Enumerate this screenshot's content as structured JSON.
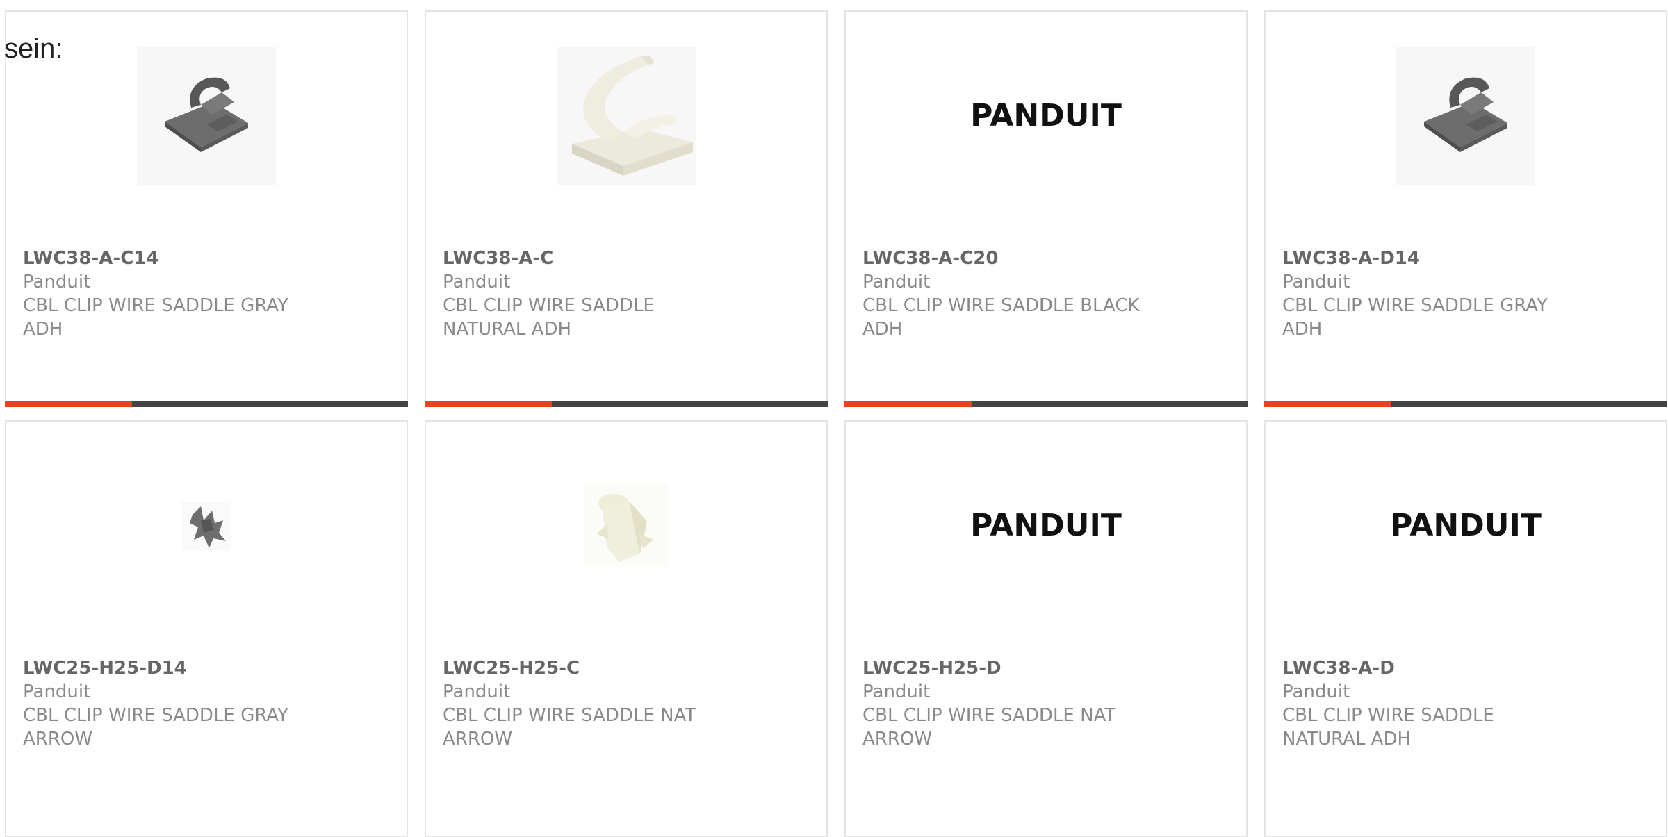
{
  "intro_text": "sein:",
  "colors": {
    "accent": "#e8431f",
    "bar_dark": "#444444",
    "card_border": "#e4e4e4",
    "text_gray": "#8a8a8a"
  },
  "products": [
    {
      "part": "LWC38-A-C14",
      "brand": "Panduit",
      "desc_line1": "CBL CLIP WIRE SADDLE GRAY",
      "desc_line2": "ADH",
      "image": "gray-adhesive-clip-image"
    },
    {
      "part": "LWC38-A-C",
      "brand": "Panduit",
      "desc_line1": "CBL CLIP WIRE SADDLE",
      "desc_line2": "NATURAL ADH",
      "image": "natural-adhesive-clip-image"
    },
    {
      "part": "LWC38-A-C20",
      "brand": "Panduit",
      "desc_line1": "CBL CLIP WIRE SADDLE BLACK",
      "desc_line2": "ADH",
      "image": "panduit-logo",
      "logo_text": "PANDUIT"
    },
    {
      "part": "LWC38-A-D14",
      "brand": "Panduit",
      "desc_line1": "CBL CLIP WIRE SADDLE GRAY",
      "desc_line2": "ADH",
      "image": "gray-adhesive-clip-image"
    },
    {
      "part": "LWC25-H25-D14",
      "brand": "Panduit",
      "desc_line1": "CBL CLIP WIRE SADDLE GRAY",
      "desc_line2": "ARROW",
      "image": "gray-arrow-clip-image"
    },
    {
      "part": "LWC25-H25-C",
      "brand": "Panduit",
      "desc_line1": "CBL CLIP WIRE SADDLE NAT",
      "desc_line2": "ARROW",
      "image": "natural-arrow-clip-image"
    },
    {
      "part": "LWC25-H25-D",
      "brand": "Panduit",
      "desc_line1": "CBL CLIP WIRE SADDLE NAT",
      "desc_line2": "ARROW",
      "image": "panduit-logo",
      "logo_text": "PANDUIT"
    },
    {
      "part": "LWC38-A-D",
      "brand": "Panduit",
      "desc_line1": "CBL CLIP WIRE SADDLE",
      "desc_line2": "NATURAL ADH",
      "image": "panduit-logo",
      "logo_text": "PANDUIT"
    }
  ],
  "progress_fraction": 0.315
}
